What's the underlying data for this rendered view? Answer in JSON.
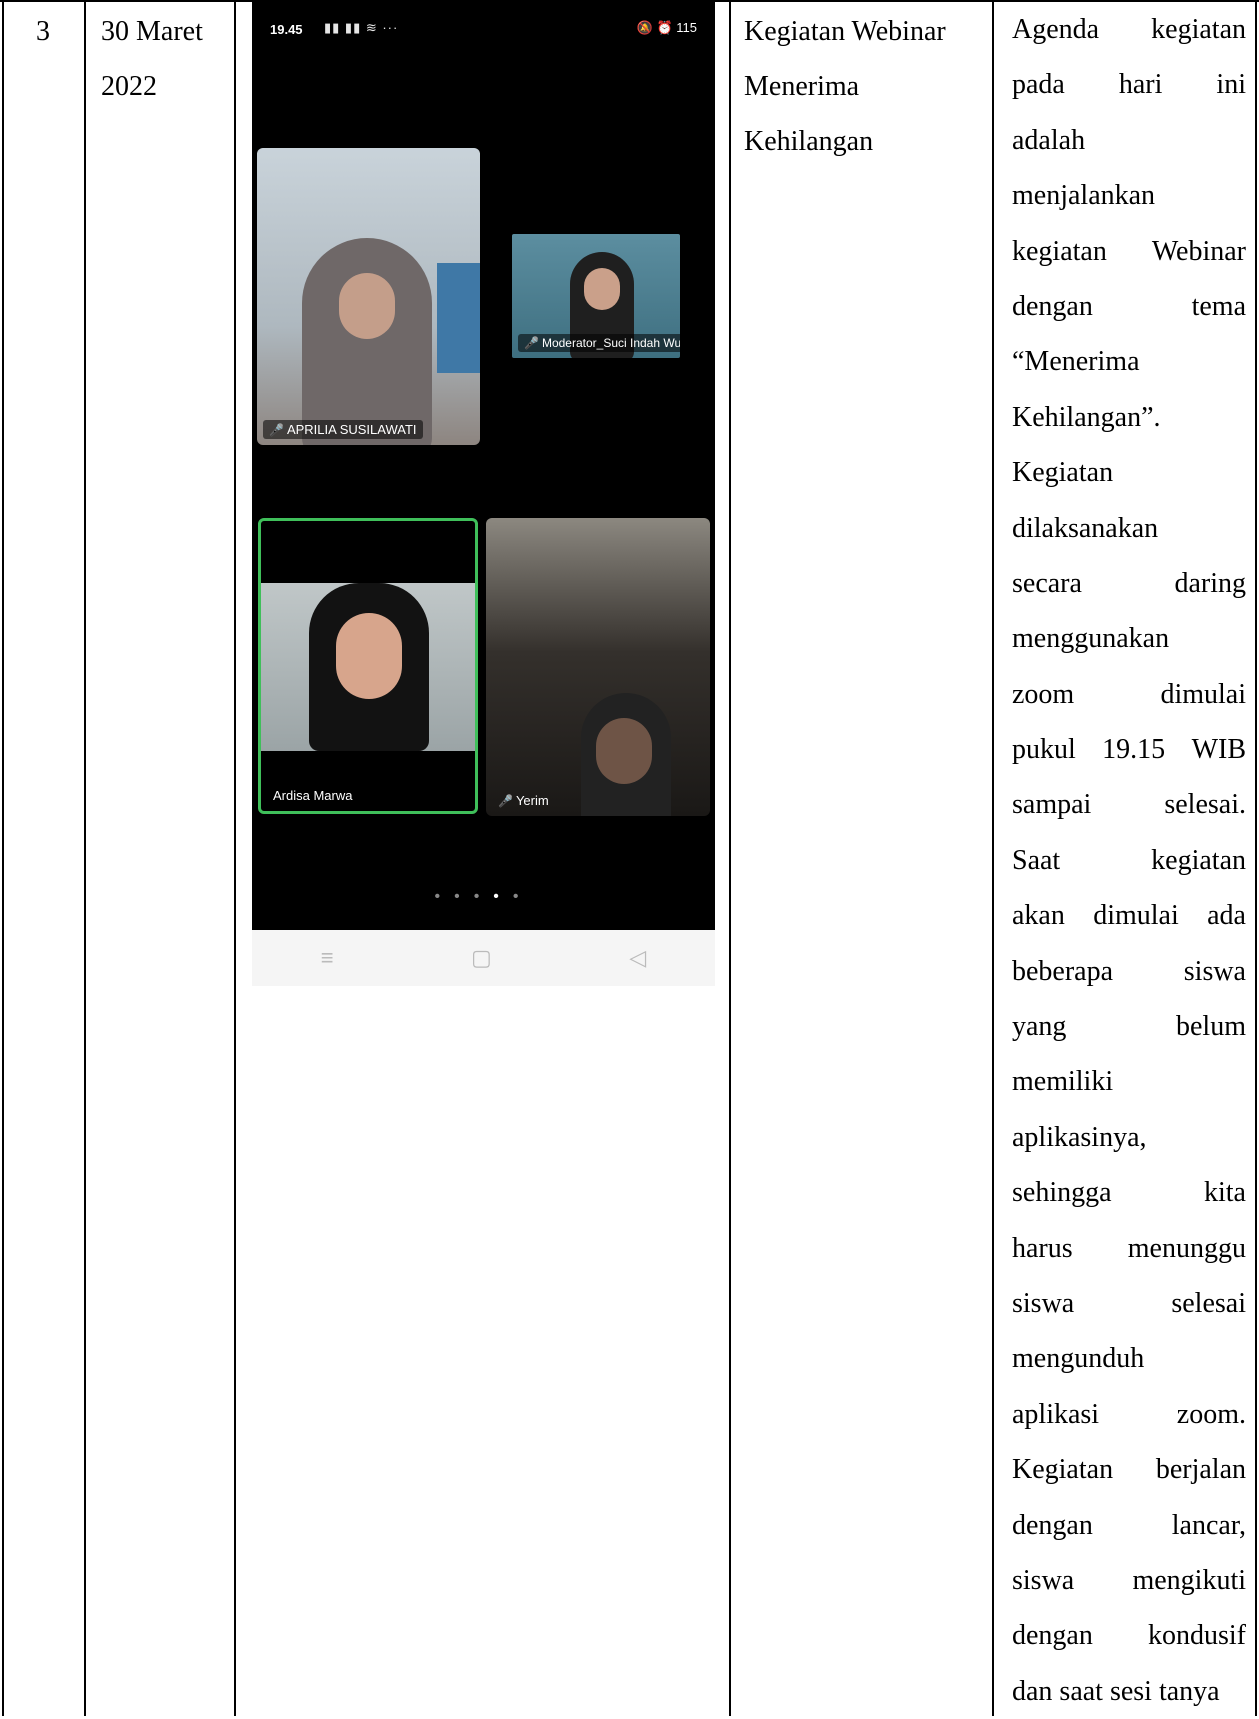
{
  "row": {
    "number": "3",
    "date_line1": "30 Maret",
    "date_line2": "2022",
    "activity_line1": "Kegiatan Webinar",
    "activity_line2": "Menerima",
    "activity_line3": "Kehilangan"
  },
  "description_lines": [
    [
      "Agenda",
      "kegiatan"
    ],
    [
      "pada",
      "hari",
      "ini"
    ],
    [
      "adalah"
    ],
    [
      "menjalankan"
    ],
    [
      "kegiatan",
      "Webinar"
    ],
    [
      "dengan",
      "tema"
    ],
    [
      "“Menerima"
    ],
    [
      "Kehilangan”."
    ],
    [
      "Kegiatan"
    ],
    [
      "dilaksanakan"
    ],
    [
      "secara",
      "daring"
    ],
    [
      "menggunakan"
    ],
    [
      "zoom",
      "dimulai"
    ],
    [
      "pukul",
      "19.15",
      "WIB"
    ],
    [
      "sampai",
      "selesai."
    ],
    [
      "Saat",
      "kegiatan"
    ],
    [
      "akan",
      "dimulai",
      "ada"
    ],
    [
      "beberapa",
      "siswa"
    ],
    [
      "yang",
      "belum"
    ],
    [
      "memiliki"
    ],
    [
      "aplikasinya,"
    ],
    [
      "sehingga",
      "kita"
    ],
    [
      "harus",
      "menunggu"
    ],
    [
      "siswa",
      "selesai"
    ],
    [
      "mengunduh"
    ],
    [
      "aplikasi",
      "zoom."
    ],
    [
      "Kegiatan",
      "berjalan"
    ],
    [
      "dengan",
      "lancar,"
    ],
    [
      "siswa",
      "mengikuti"
    ],
    [
      "dengan",
      "kondusif"
    ],
    [
      "dan saat sesi tanya"
    ]
  ],
  "phone": {
    "status_time": "19.45",
    "status_icons": "▮▮ ▮▮ ≋ ···",
    "status_right": "🔕 ⏰ 115",
    "participants": [
      {
        "name": "APRILIA SUSILAWATI",
        "muted": true
      },
      {
        "name": "Moderator_Suci Indah Wulan...",
        "muted": true
      },
      {
        "name": "Ardisa Marwa",
        "muted": false
      },
      {
        "name": "Yerim",
        "muted": true
      }
    ],
    "nav": [
      "≡",
      "▢",
      "◁"
    ]
  }
}
